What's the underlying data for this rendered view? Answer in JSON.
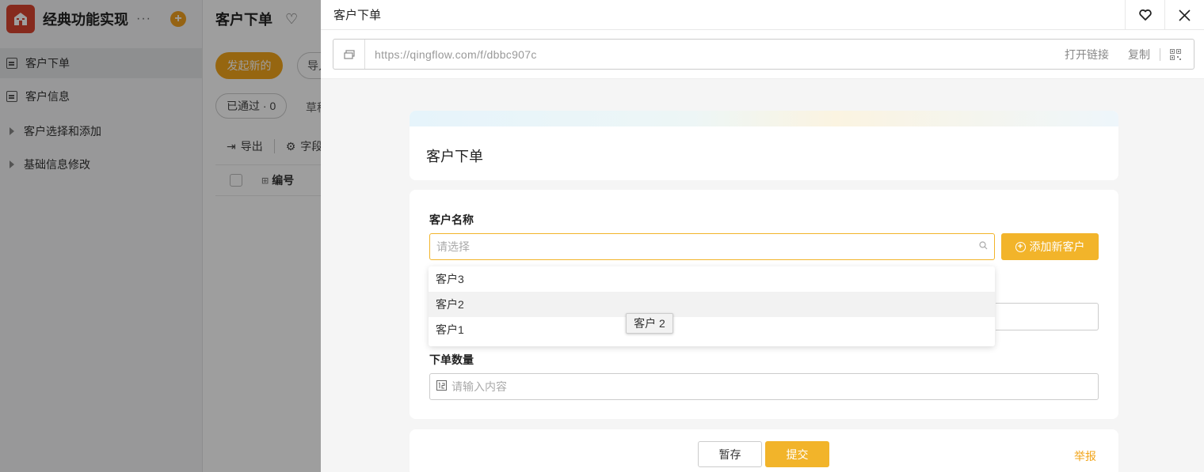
{
  "app": {
    "title": "经典功能实现",
    "more": "···",
    "add_symbol": "+"
  },
  "sidebar": {
    "items": [
      {
        "label": "客户下单"
      },
      {
        "label": "客户信息"
      },
      {
        "label": "客户选择和添加"
      },
      {
        "label": "基础信息修改"
      }
    ]
  },
  "main": {
    "title": "客户下单",
    "new_button": "发起新的",
    "import_button": "导入",
    "status_pill": "已通过 · 0",
    "draft_tab": "草稿",
    "toolbar": {
      "export": "导出",
      "fields": "字段"
    },
    "table": {
      "col_number": "编号"
    }
  },
  "drawer": {
    "title": "客户下单",
    "url": "https://qingflow.com/f/dbbc907c",
    "open_link": "打开链接",
    "copy": "复制",
    "form": {
      "title": "客户下单",
      "customer_label": "客户名称",
      "customer_placeholder": "请选择",
      "add_customer_button": "添加新客户",
      "quantity_label": "下单数量",
      "quantity_placeholder": "请输入内容",
      "options": [
        "客户3",
        "客户2",
        "客户1"
      ],
      "tooltip": "客户 2"
    },
    "footer": {
      "save": "暂存",
      "submit": "提交",
      "report": "举报"
    }
  },
  "colors": {
    "accent": "#f2b42a",
    "brand_red": "#d9452f"
  }
}
